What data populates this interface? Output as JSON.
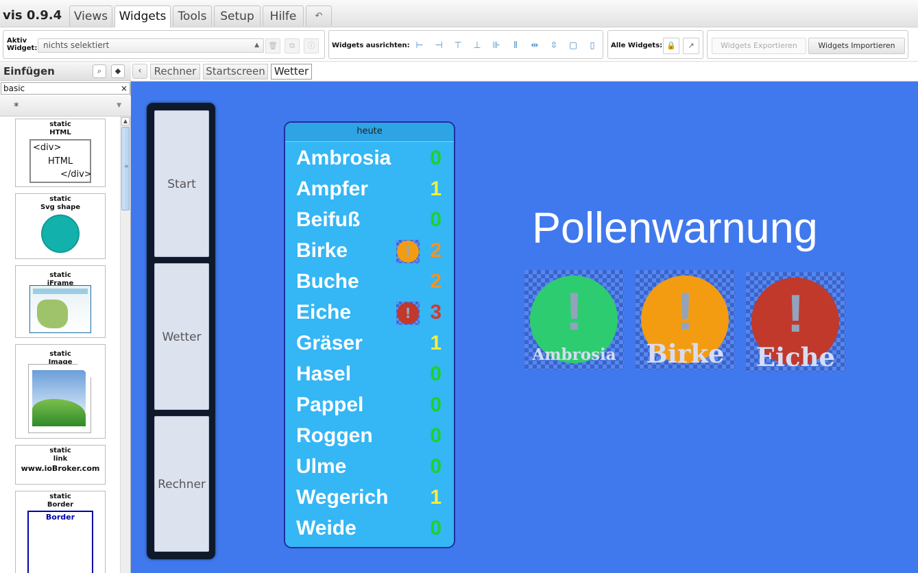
{
  "app": {
    "brand": "vis 0.9.4"
  },
  "menu": {
    "tabs": [
      {
        "label": "Views"
      },
      {
        "label": "Widgets"
      },
      {
        "label": "Tools"
      },
      {
        "label": "Setup"
      },
      {
        "label": "Hilfe"
      }
    ],
    "undo_icon": "undo-arrow-icon"
  },
  "toolbar": {
    "active_widget_label": "Aktiv Widget:",
    "active_widget_value": "nichts selektiert",
    "align_label": "Widgets ausrichten:",
    "all_widgets_label": "Alle Widgets:",
    "export_label": "Widgets Exportieren",
    "import_label": "Widgets Importieren"
  },
  "sidebar": {
    "title": "Einfügen",
    "filter": "basic",
    "filter_clear": "×",
    "set": "*",
    "widgets": [
      {
        "type": "static",
        "name": "HTML",
        "preview": [
          "<div>",
          "HTML",
          "</div>"
        ]
      },
      {
        "type": "static",
        "name": "Svg shape"
      },
      {
        "type": "static",
        "name": "iFrame"
      },
      {
        "type": "static",
        "name": "Image"
      },
      {
        "type": "static",
        "name": "link",
        "preview_text": "www.ioBroker.com"
      },
      {
        "type": "static",
        "name": "Border",
        "preview_text": "Border"
      }
    ]
  },
  "views": {
    "tabs": [
      {
        "label": "Rechner"
      },
      {
        "label": "Startscreen"
      },
      {
        "label": "Wetter"
      }
    ],
    "active": "Wetter"
  },
  "canvas": {
    "background": "#4079ed",
    "nav_buttons": [
      {
        "label": "Start"
      },
      {
        "label": "Wetter"
      },
      {
        "label": "Rechner"
      }
    ],
    "pollen_panel": {
      "header": "heute",
      "rows": [
        {
          "name": "Ambrosia",
          "value": "0",
          "color": "#19d22e"
        },
        {
          "name": "Ampfer",
          "value": "1",
          "color": "#f3ef3b"
        },
        {
          "name": "Beifuß",
          "value": "0",
          "color": "#19d22e"
        },
        {
          "name": "Birke",
          "value": "2",
          "color": "#f39322",
          "warn": "#f39c12"
        },
        {
          "name": "Buche",
          "value": "2",
          "color": "#f39322"
        },
        {
          "name": "Eiche",
          "value": "3",
          "color": "#d23a2b",
          "warn": "#c0392b"
        },
        {
          "name": "Gräser",
          "value": "1",
          "color": "#f3ef3b"
        },
        {
          "name": "Hasel",
          "value": "0",
          "color": "#19d22e"
        },
        {
          "name": "Pappel",
          "value": "0",
          "color": "#19d22e"
        },
        {
          "name": "Roggen",
          "value": "0",
          "color": "#19d22e"
        },
        {
          "name": "Ulme",
          "value": "0",
          "color": "#19d22e"
        },
        {
          "name": "Wegerich",
          "value": "1",
          "color": "#f3ef3b"
        },
        {
          "name": "Weide",
          "value": "0",
          "color": "#19d22e"
        }
      ]
    },
    "title": "Pollenwarnung",
    "warnings": [
      {
        "label": "Ambrosia",
        "color": "#2ecc71"
      },
      {
        "label": "Birke",
        "color": "#f39c12"
      },
      {
        "label": "Eiche",
        "color": "#c0392b"
      }
    ]
  }
}
